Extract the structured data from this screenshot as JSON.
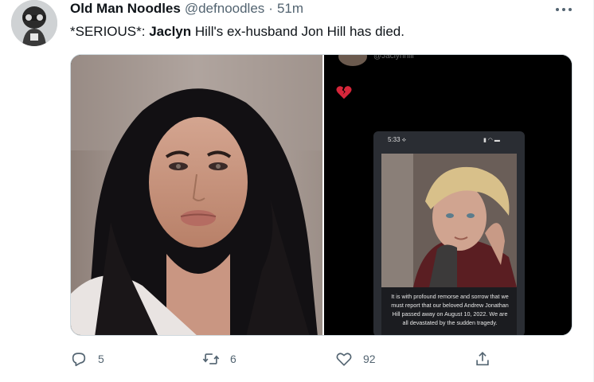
{
  "tweet": {
    "author_name": "Old Man Noodles",
    "handle": "@defnoodles",
    "separator": "·",
    "time": "51m",
    "text_prefix": "*SERIOUS*: ",
    "text_bold": "Jaclyn",
    "text_suffix": " Hill's ex-husband Jon Hill has died."
  },
  "media": {
    "story_handle": "@Jaclynhill",
    "phone_time": "5:33 ⟡",
    "phone_status": "▮ ◠ ▬",
    "caption": "It is with profound remorse and sorrow that we must report that our beloved Andrew Jonathan Hill passed away on August 10, 2022. We are all devastated by the sudden tragedy."
  },
  "actions": {
    "reply_count": "5",
    "retweet_count": "6",
    "like_count": "92"
  },
  "icons": {
    "reply": "reply-icon",
    "retweet": "retweet-icon",
    "like": "heart-icon",
    "share": "share-icon",
    "more": "more-icon"
  },
  "colors": {
    "text_primary": "#0f1419",
    "text_secondary": "#536471",
    "heart_emoji": "#d6263a"
  }
}
